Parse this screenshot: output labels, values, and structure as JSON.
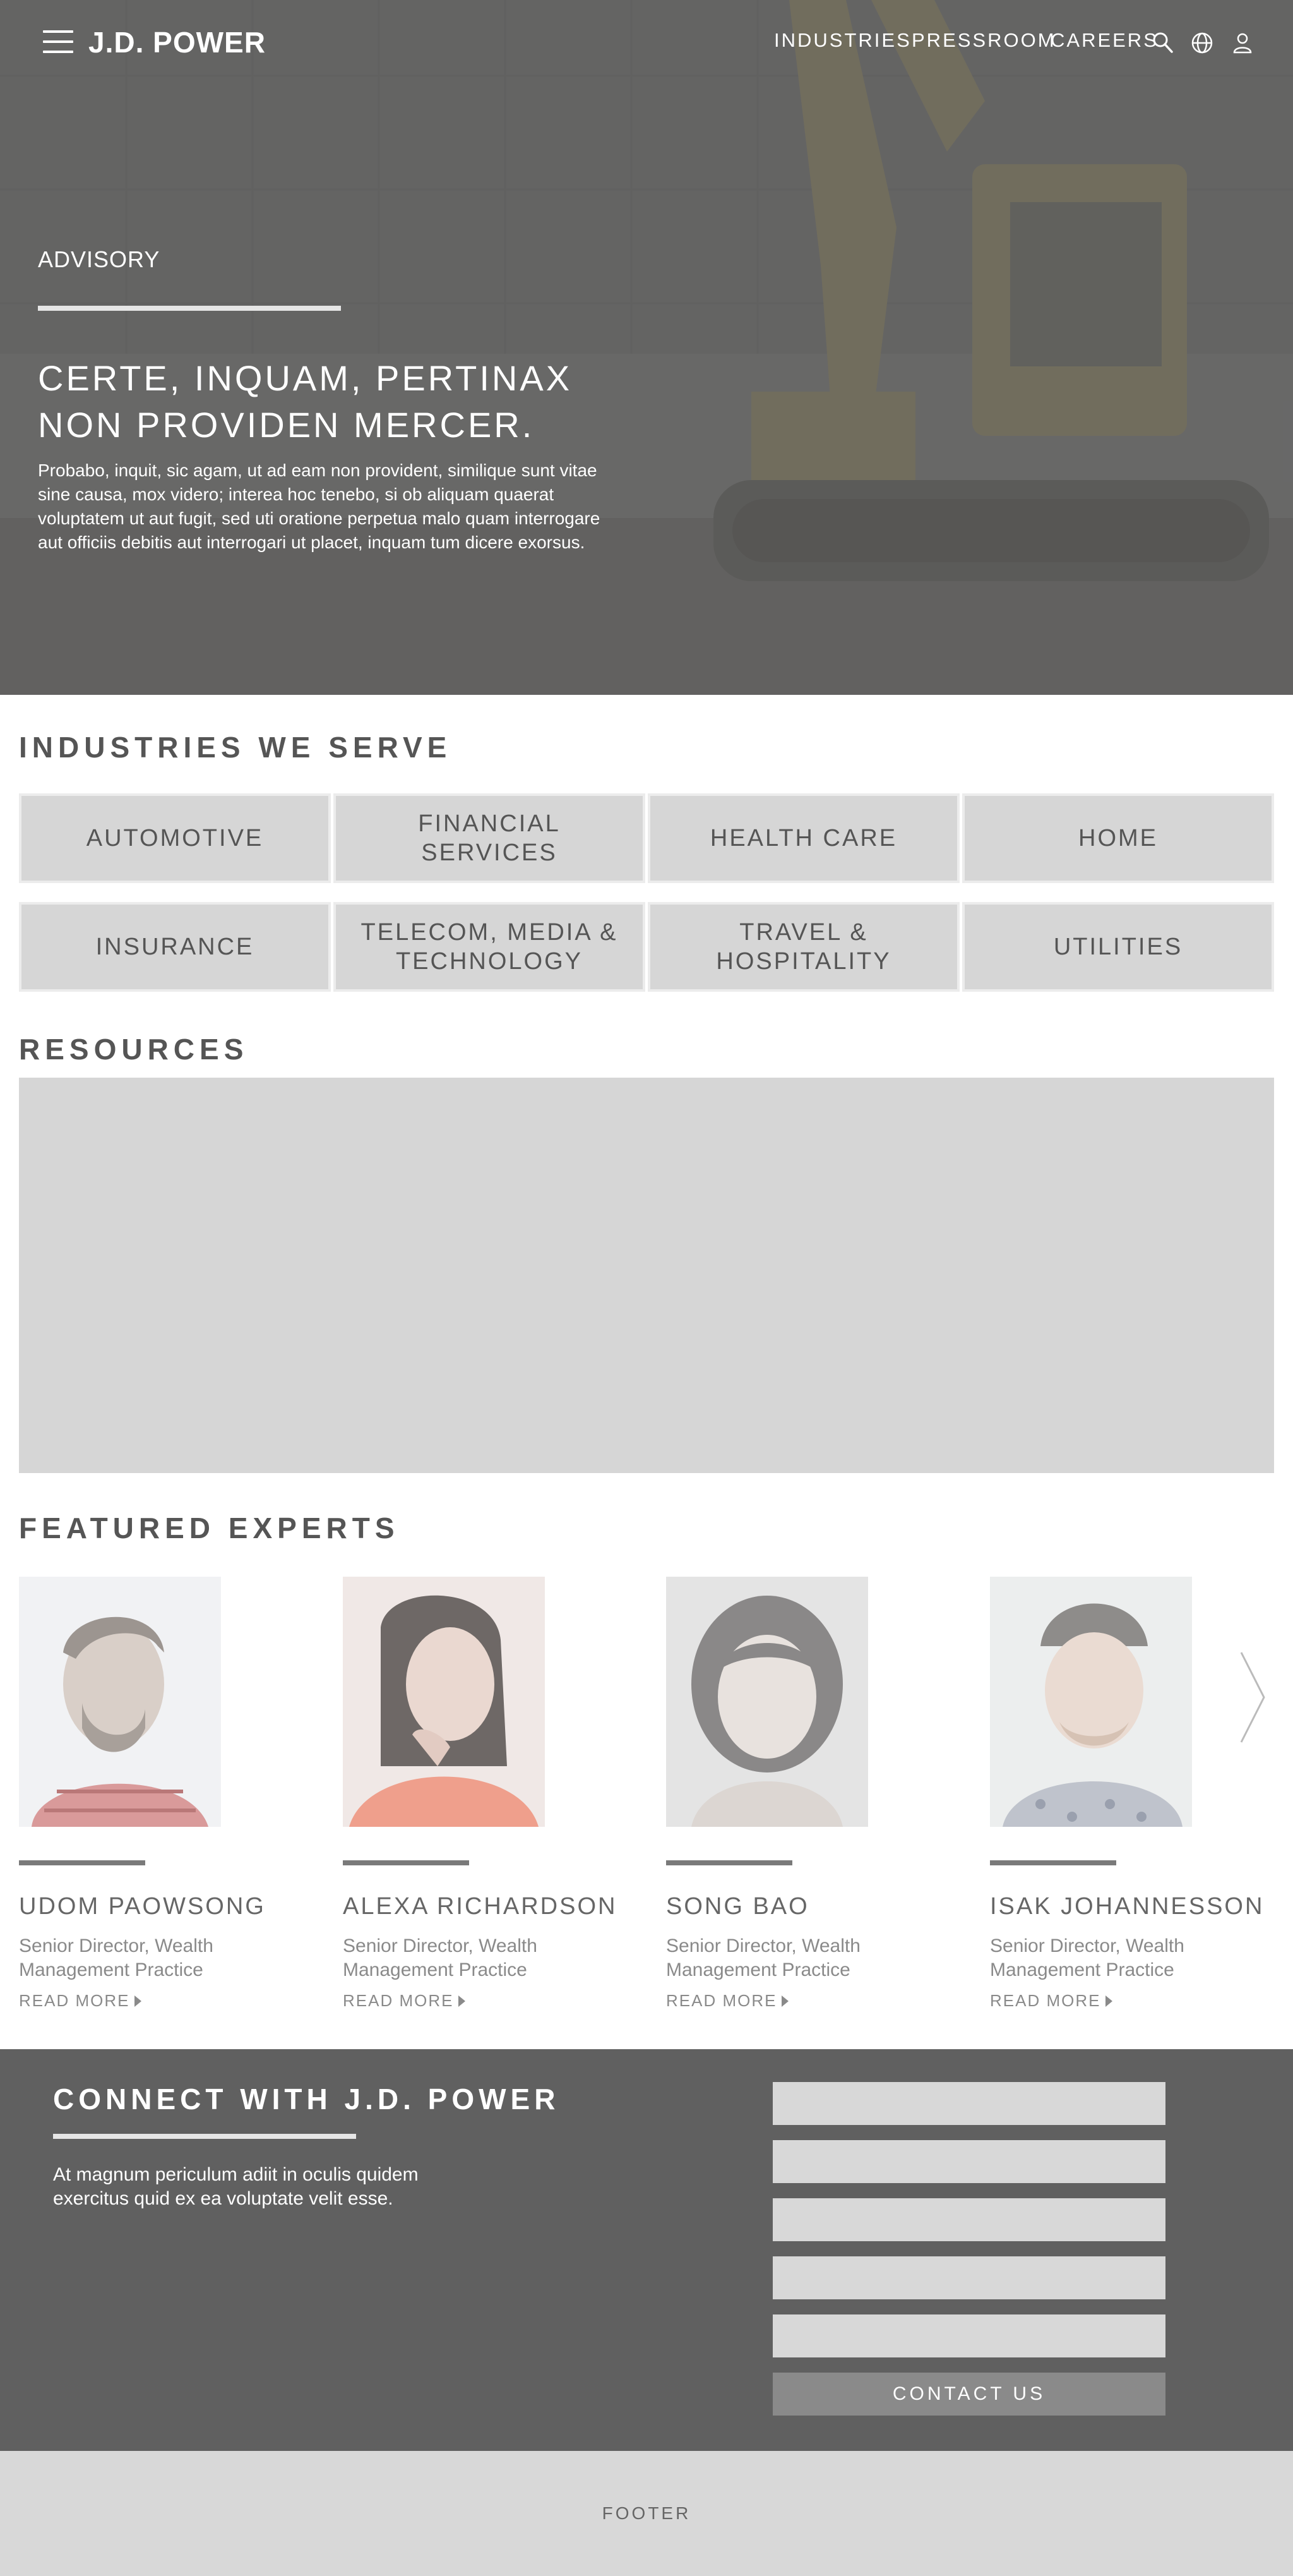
{
  "header": {
    "logo": "J.D. POWER",
    "nav": [
      {
        "label": "INDUSTRIES"
      },
      {
        "label": "PRESSROOM"
      },
      {
        "label": "CAREERS"
      }
    ],
    "icons": [
      "menu-icon",
      "search-icon",
      "globe-icon",
      "user-icon"
    ]
  },
  "hero": {
    "eyebrow": "ADVISORY",
    "title": "CERTE, INQUAM, PERTINAX NON PROVIDEN MERCER.",
    "description": "Probabo, inquit, sic agam, ut ad eam non provident, similique sunt vitae sine causa, mox videro; interea hoc tenebo, si ob aliquam quaerat voluptatem ut aut fugit, sed uti oratione perpetua malo quam interrogare aut officiis debitis aut interrogari ut placet, inquam tum dicere exorsus."
  },
  "industries": {
    "heading": "INDUSTRIES WE SERVE",
    "tiles": [
      {
        "label": "AUTOMOTIVE"
      },
      {
        "label": "FINANCIAL SERVICES"
      },
      {
        "label": "HEALTH CARE"
      },
      {
        "label": "HOME"
      },
      {
        "label": "INSURANCE"
      },
      {
        "label": "TELECOM, MEDIA & TECHNOLOGY"
      },
      {
        "label": "TRAVEL & HOSPITALITY"
      },
      {
        "label": "UTILITIES"
      }
    ]
  },
  "resources": {
    "heading": "RESOURCES"
  },
  "experts": {
    "heading": "FEATURED EXPERTS",
    "items": [
      {
        "name": "UDOM PAOWSONG",
        "title": "Senior Director, Wealth Management Practice",
        "link": "READ MORE"
      },
      {
        "name": "ALEXA RICHARDSON",
        "title": "Senior Director, Wealth Management Practice",
        "link": "READ MORE"
      },
      {
        "name": "SONG BAO",
        "title": "Senior Director, Wealth Management Practice",
        "link": "READ MORE"
      },
      {
        "name": "ISAK JOHANNESSON",
        "title": "Senior Director, Wealth Management Practice",
        "link": "READ MORE"
      }
    ]
  },
  "connect": {
    "title": "CONNECT WITH J.D. POWER",
    "text": "At magnum periculum adiit in oculis quidem exercitus quid ex ea voluptate velit esse.",
    "button": "CONTACT US"
  },
  "footer": {
    "label": "FOOTER"
  },
  "colors": {
    "hero_overlay": "#5a5a5a",
    "tile_bg": "#d6d6d6",
    "connect_bg": "#606060",
    "footer_bg": "#d8d8d8",
    "button_bg": "#8a8a8a"
  }
}
